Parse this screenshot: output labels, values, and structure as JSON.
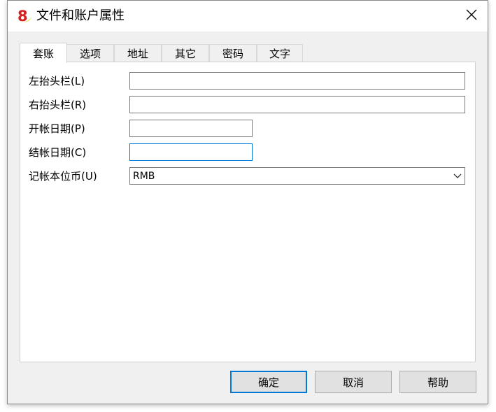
{
  "window": {
    "title": "文件和账户属性",
    "colors": {
      "accent": "#0078d7",
      "icon_red": "#d62020",
      "icon_yellow": "#f4c400"
    }
  },
  "tabs": [
    {
      "label": "套账",
      "active": true
    },
    {
      "label": "选项",
      "active": false
    },
    {
      "label": "地址",
      "active": false
    },
    {
      "label": "其它",
      "active": false
    },
    {
      "label": "密码",
      "active": false
    },
    {
      "label": "文字",
      "active": false
    }
  ],
  "form": {
    "left_header": {
      "label": "左抬头栏(L)",
      "value": ""
    },
    "right_header": {
      "label": "右抬头栏(R)",
      "value": ""
    },
    "open_date": {
      "label": "开帐日期(P)",
      "value": ""
    },
    "close_date": {
      "label": "结帐日期(C)",
      "value": ""
    },
    "currency": {
      "label": "记帐本位币(U)",
      "value": "RMB"
    }
  },
  "buttons": {
    "ok": "确定",
    "cancel": "取消",
    "help": "帮助"
  },
  "icons": {
    "app": "app-logo-icon",
    "close": "close-icon",
    "dropdown": "chevron-down-icon"
  }
}
